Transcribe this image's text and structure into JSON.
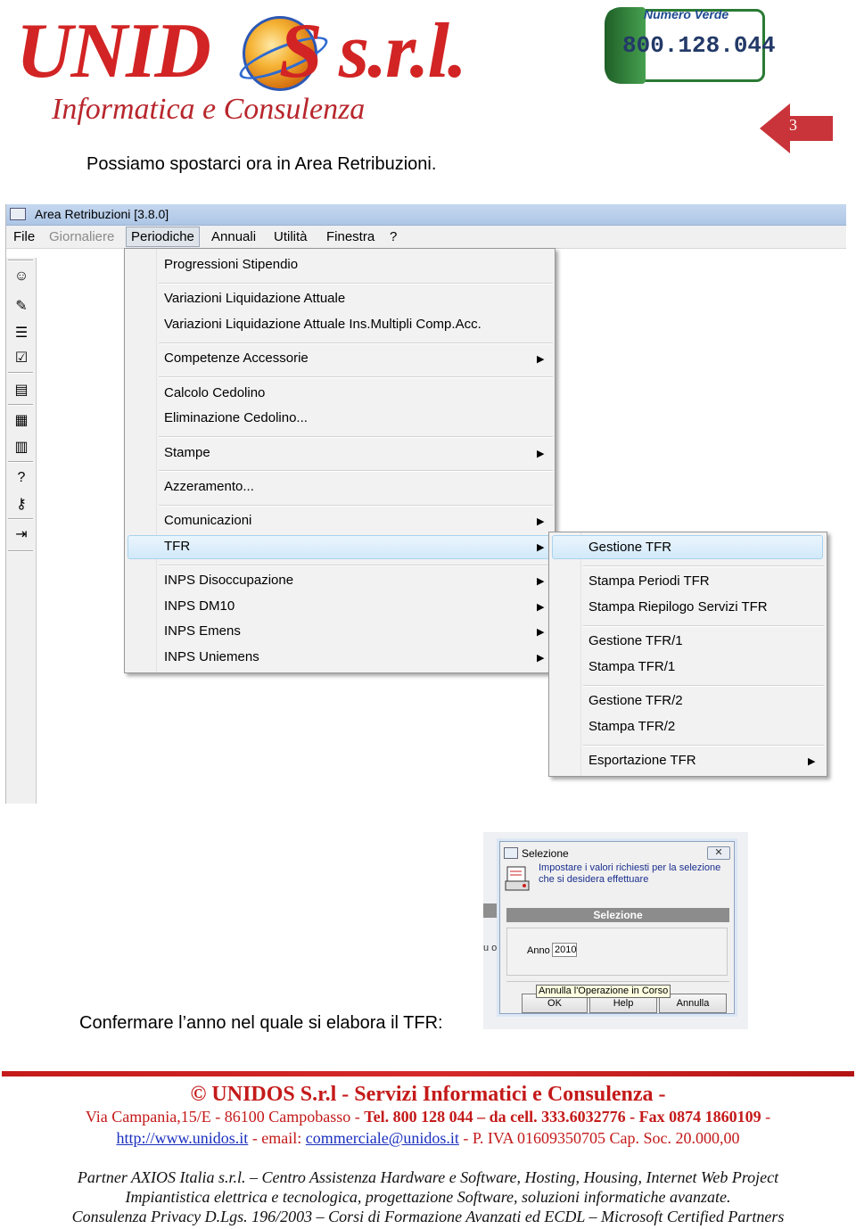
{
  "header": {
    "logo_text": "UNIDOS s.r.l.",
    "logo_subtitle": "Informatica e Consulenza",
    "numero_verde_label": "Numero Verde",
    "numero_verde_number": "800.128.044",
    "page_number": "3"
  },
  "intro_text": "Possiamo spostarci ora in Area Retribuzioni.",
  "app": {
    "title": "Area Retribuzioni [3.8.0]",
    "menubar": [
      {
        "label": "File",
        "state": "normal"
      },
      {
        "label": "Giornaliere",
        "state": "disabled"
      },
      {
        "label": "Periodiche",
        "state": "open"
      },
      {
        "label": "Annuali",
        "state": "normal"
      },
      {
        "label": "Utilità",
        "state": "normal"
      },
      {
        "label": "Finestra",
        "state": "normal"
      },
      {
        "label": "?",
        "state": "normal"
      }
    ],
    "toolbar_icons": [
      "user-icon",
      "pencil-icon",
      "list-icon",
      "edit-check-icon",
      "book-icon",
      "calculator-icon",
      "grid-icon",
      "help-icon",
      "key-icon",
      "exit-icon"
    ],
    "menu": [
      {
        "label": "Progressioni Stipendio",
        "submenu": false
      },
      {
        "label": "Variazioni Liquidazione Attuale",
        "submenu": false
      },
      {
        "label": "Variazioni Liquidazione Attuale Ins.Multipli Comp.Acc.",
        "submenu": false
      },
      {
        "label": "Competenze Accessorie",
        "submenu": true
      },
      {
        "label": "Calcolo Cedolino",
        "submenu": false
      },
      {
        "label": "Eliminazione Cedolino...",
        "submenu": false
      },
      {
        "label": "Stampe",
        "submenu": true
      },
      {
        "label": "Azzeramento...",
        "submenu": false
      },
      {
        "label": "Comunicazioni",
        "submenu": true
      },
      {
        "label": "TFR",
        "submenu": true,
        "highlighted": true
      },
      {
        "label": "INPS Disoccupazione",
        "submenu": true
      },
      {
        "label": "INPS DM10",
        "submenu": true
      },
      {
        "label": "INPS Emens",
        "submenu": true
      },
      {
        "label": "INPS Uniemens",
        "submenu": true
      }
    ],
    "submenu": [
      {
        "label": "Gestione TFR",
        "submenu": false,
        "highlighted": true
      },
      {
        "label": "Stampa Periodi TFR",
        "submenu": false
      },
      {
        "label": "Stampa Riepilogo Servizi TFR",
        "submenu": false
      },
      {
        "label": "Gestione TFR/1",
        "submenu": false
      },
      {
        "label": "Stampa TFR/1",
        "submenu": false
      },
      {
        "label": "Gestione TFR/2",
        "submenu": false
      },
      {
        "label": "Stampa TFR/2",
        "submenu": false
      },
      {
        "label": "Esportazione TFR",
        "submenu": true
      }
    ]
  },
  "dialog": {
    "title": "Selezione",
    "close_glyph": "✕",
    "description": "Impostare i valori richiesti per la selezione che si desidera effettuare",
    "section_bar": "Selezione",
    "anno_label": "Anno",
    "anno_value": "2010",
    "tooltip": "Annulla l'Operazione in Corso",
    "buttons": [
      "OK",
      "Help",
      "Annulla"
    ],
    "background_fragment": "u or"
  },
  "confirm_text": "Confermare l’anno nel quale si elabora il TFR:",
  "footer": {
    "company_line": "© UNIDOS S.r.l  - Servizi Informatici e Consulenza -",
    "address": "Via Campania,15/E - 86100 Campobasso - ",
    "tel": "Tel. 800 128 044",
    "cell_label": " – da cell. 333.6032776 - ",
    "fax": "Fax 0874 1860109",
    "fax_suffix": " -",
    "website": "http://www.unidos.it",
    "email_label": " - email: ",
    "email": "commerciale@unidos.it",
    "piva": " - P. IVA 01609350705 Cap. Soc. 20.000,00",
    "italic_line1": "Partner AXIOS Italia s.r.l. –  Centro Assistenza Hardware e Software, Hosting, Housing, Internet Web Project",
    "italic_line2": "Impiantistica elettrica e tecnologica, progettazione Software, soluzioni informatiche avanzate.",
    "italic_line3": "Consulenza Privacy D.Lgs. 196/2003 – Corsi di Formazione Avanzati ed ECDL – Microsoft Certified Partners"
  },
  "colors": {
    "brand_red": "#c41a1a",
    "link_blue": "#1a2fbf",
    "menu_highlight": "#d2e9f9",
    "green_numero_verde": "#2a7a34"
  }
}
